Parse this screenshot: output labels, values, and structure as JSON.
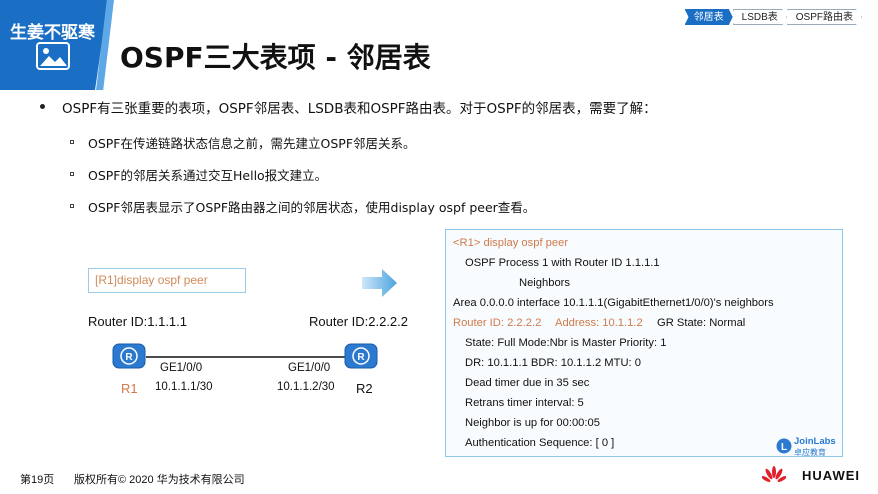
{
  "header": {
    "watermark": "生姜不驱寒",
    "title": "OSPF三大表项 - 邻居表",
    "tabs": [
      "邻居表",
      "LSDB表",
      "OSPF路由表"
    ],
    "active_tab": 0,
    "accent_color": "#1a6fc4"
  },
  "bullets": {
    "main": "OSPF有三张重要的表项，OSPF邻居表、LSDB表和OSPF路由表。对于OSPF的邻居表，需要了解：",
    "sub": [
      "OSPF在传递链路状态信息之前，需先建立OSPF邻居关系。",
      "OSPF的邻居关系通过交互Hello报文建立。",
      "OSPF邻居表显示了OSPF路由器之间的邻居状态，使用display ospf peer查看。"
    ]
  },
  "diagram": {
    "command": "[R1]display ospf peer",
    "r1": {
      "router_id": "Router ID:1.1.1.1",
      "name": "R1",
      "iface": "GE1/0/0",
      "ip": "10.1.1.1/30"
    },
    "r2": {
      "router_id": "Router ID:2.2.2.2",
      "name": "R2",
      "iface": "GE1/0/0",
      "ip": "10.1.1.2/30"
    }
  },
  "output": {
    "line1": "<R1> display ospf peer",
    "line2": "OSPF Process 1 with Router ID 1.1.1.1",
    "line3": "Neighbors",
    "line4": "Area 0.0.0.0 interface 10.1.1.1(GigabitEthernet1/0/0)'s neighbors",
    "line5a": "Router ID: 2.2.2.2",
    "line5b": "Address: 10.1.1.2",
    "line5c": "GR State: Normal",
    "line6": "State: Full  Mode:Nbr is  Master  Priority: 1",
    "line7": "DR: 10.1.1.1  BDR: 10.1.1.2   MTU: 0",
    "line8": "Dead timer due in 35  sec",
    "line9": "Retrans timer interval: 5",
    "line10": "Neighbor is up for 00:00:05",
    "line11": "Authentication Sequence: [ 0 ]",
    "logo_text": "JoinLabs",
    "logo_sub": "卓应教育"
  },
  "footer": {
    "page": "第19页",
    "copyright": "版权所有© 2020 华为技术有限公司",
    "brand": "HUAWEI"
  }
}
